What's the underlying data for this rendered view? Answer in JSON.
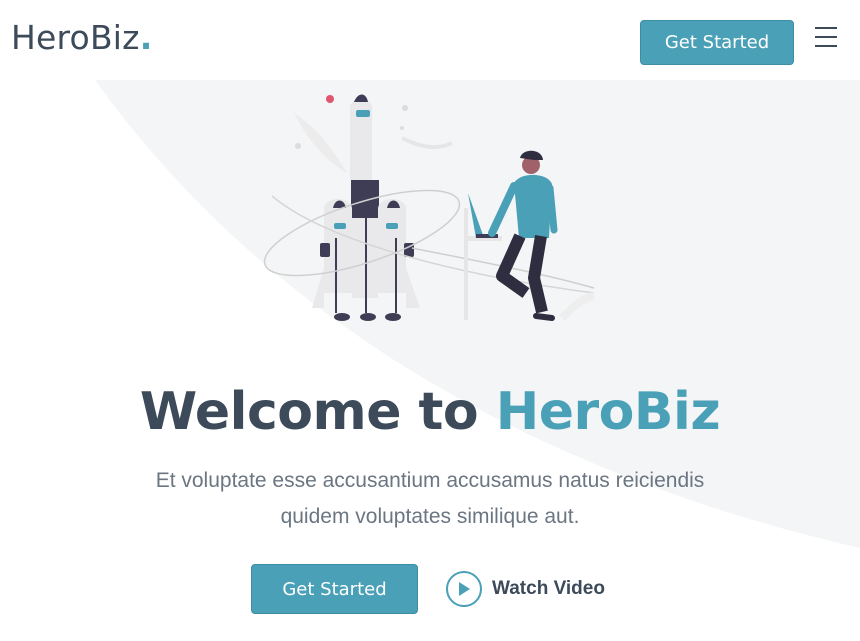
{
  "header": {
    "logo_text": "HeroBiz",
    "logo_dot": ".",
    "cta_label": "Get Started",
    "menu_icon": "hamburger-menu-icon"
  },
  "hero": {
    "title_main": "Welcome to ",
    "title_accent": "HeroBiz",
    "subtitle": "Et voluptate esse accusantium accusamus natus reiciendis quidem voluptates similique aut.",
    "primary_button": "Get Started",
    "video_button": "Watch Video",
    "video_icon": "play-icon",
    "illustration": "rocket-launch-illustration"
  },
  "colors": {
    "accent": "#4aa0b7",
    "text_dark": "#3c4a59",
    "text_muted": "#6b7682"
  }
}
